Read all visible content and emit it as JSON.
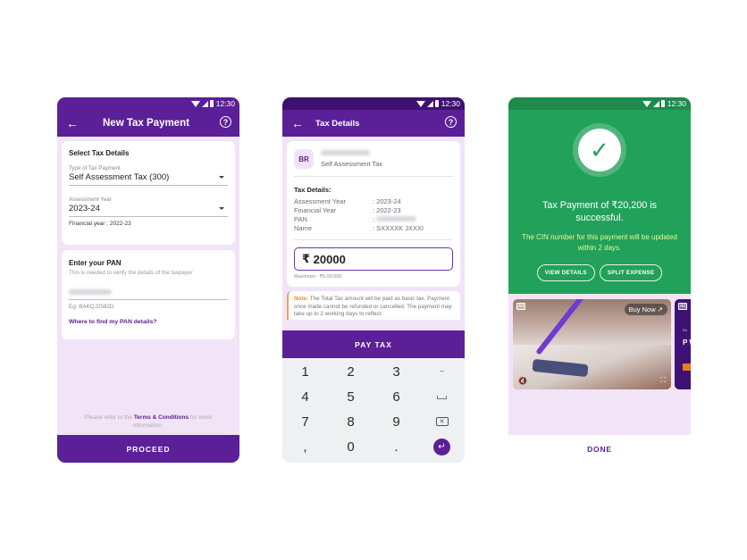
{
  "statusbar": {
    "time": "12:30"
  },
  "screen1": {
    "title": "New Tax Payment",
    "select_card": {
      "title": "Select Tax Details",
      "type_label": "Type of Tax Payment",
      "type_value": "Self Assessment Tax (300)",
      "year_label": "Assessment Year",
      "year_value": "2023-24",
      "financial_year": "Financial year : 2022-23"
    },
    "pan_card": {
      "title": "Enter your PAN",
      "subtitle": "This is needed to verify the details of the taxpayer",
      "example": "Eg: BAKQJ2582D",
      "help_link": "Where to find my PAN details?"
    },
    "footnote_prefix": "Please refer to the ",
    "footnote_link": "Terms & Conditions",
    "footnote_suffix": " for more information.",
    "proceed_label": "PROCEED"
  },
  "screen2": {
    "title": "Tax Details",
    "badge": "BR",
    "tax_type": "Self Assessment Tax",
    "details_title": "Tax Details:",
    "rows": [
      {
        "key": "Assessment Year",
        "value": ":  2023-24"
      },
      {
        "key": "Financial Year",
        "value": ":  2022-23"
      },
      {
        "key": "PAN",
        "value": ":"
      },
      {
        "key": "Name",
        "value": ": SXXXXK JXXXI"
      }
    ],
    "currency": "₹",
    "amount": "20000",
    "maximum": "Maximum : ₹5,00,000",
    "note_label": "Note:",
    "note_text": " The Total Tax amount will be paid as basic tax. Payment once made cannot be refunded or cancelled. The payment may take up to 2 working days to reflect.",
    "pay_label": "PAY TAX",
    "keypad": [
      "1",
      "2",
      "3",
      "−",
      "4",
      "5",
      "6",
      "␣",
      "7",
      "8",
      "9",
      "⌫",
      ",",
      "0",
      ".",
      "↵"
    ]
  },
  "screen3": {
    "success_text": "Tax Payment of ₹20,200 is successful.",
    "cin_text": "The CIN number for this payment will be updated within 2 days.",
    "view_details": "VIEW DETAILS",
    "split_expense": "SPLIT EXPENSE",
    "ad_tag": "Ad",
    "buy_now": "Buy Now",
    "ad2_text": "P W",
    "done_label": "DONE"
  }
}
